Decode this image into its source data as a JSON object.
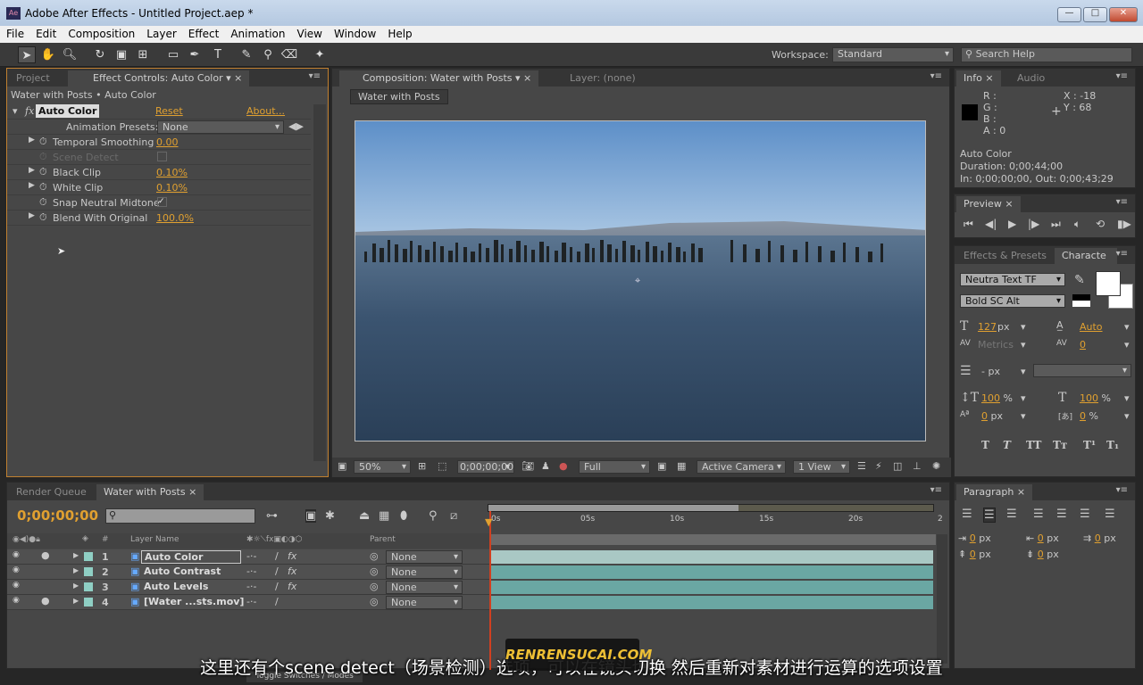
{
  "window": {
    "title": "Adobe After Effects - Untitled Project.aep *",
    "logo": "Ae"
  },
  "menu": [
    "File",
    "Edit",
    "Composition",
    "Layer",
    "Effect",
    "Animation",
    "View",
    "Window",
    "Help"
  ],
  "toolbar": {
    "workspace_label": "Workspace:",
    "workspace_value": "Standard",
    "search_placeholder": "Search Help"
  },
  "left_panel": {
    "tabs": [
      "Project",
      "Effect Controls: Auto Color"
    ],
    "breadcrumb": "Water with Posts • Auto Color",
    "effect": {
      "name": "Auto Color",
      "reset": "Reset",
      "about": "About...",
      "presets_label": "Animation Presets:",
      "presets_value": "None",
      "params": [
        {
          "label": "Temporal Smoothing",
          "value": "0.00",
          "expandable": true
        },
        {
          "label": "Scene Detect",
          "value": "",
          "disabled": true
        },
        {
          "label": "Black Clip",
          "value": "0.10%",
          "expandable": true
        },
        {
          "label": "White Clip",
          "value": "0.10%",
          "expandable": true
        },
        {
          "label": "Snap Neutral Midtone",
          "value": "✓"
        },
        {
          "label": "Blend With Original",
          "value": "100.0%",
          "expandable": true
        }
      ]
    }
  },
  "comp_panel": {
    "tabs": [
      "Composition: Water with Posts",
      "Layer: (none)"
    ],
    "comp_button": "Water with Posts",
    "footer": {
      "zoom": "50%",
      "timecode": "0;00;00;00",
      "resolution": "Full",
      "camera": "Active Camera",
      "view": "1 View"
    }
  },
  "info_panel": {
    "tabs": [
      "Info",
      "Audio"
    ],
    "r": "R :",
    "g": "G :",
    "b": "B :",
    "a": "A : 0",
    "x": "X : -18",
    "y": "Y : 68",
    "layer": "Auto Color",
    "duration": "Duration: 0;00;44;00",
    "inout": "In: 0;00;00;00, Out: 0;00;43;29"
  },
  "preview_panel": {
    "tab": "Preview"
  },
  "character_panel": {
    "tabs": [
      "Effects & Presets",
      "Characte"
    ],
    "font": "Neutra Text TF",
    "style": "Bold SC Alt",
    "size": "127",
    "size_unit": "px",
    "leading": "Auto",
    "kerning": "Metrics",
    "tracking": "0",
    "stroke": "-",
    "stroke_unit": "px",
    "vscale": "100",
    "hscale": "100",
    "baseline": "0",
    "tsume": "0",
    "pct": "%",
    "px": "px",
    "styles": [
      "T",
      "T",
      "TT",
      "Tт",
      "T¹",
      "T₁"
    ]
  },
  "paragraph_panel": {
    "tab": "Paragraph",
    "indents": [
      "0",
      "0",
      "0",
      "0",
      "0"
    ],
    "unit": "px"
  },
  "timeline": {
    "tabs": [
      "Render Queue",
      "Water with Posts"
    ],
    "timecode": "0;00;00;00",
    "ruler": [
      "0s",
      "05s",
      "10s",
      "15s",
      "20s",
      "2"
    ],
    "col_layer_name": "Layer Name",
    "col_parent": "Parent",
    "col_num": "#",
    "layers": [
      {
        "num": "1",
        "name": "Auto Color",
        "fx": "fx",
        "parent": "None"
      },
      {
        "num": "2",
        "name": "Auto Contrast",
        "fx": "fx",
        "parent": "None"
      },
      {
        "num": "3",
        "name": "Auto Levels",
        "fx": "fx",
        "parent": "None"
      },
      {
        "num": "4",
        "name": "[Water ...sts.mov]",
        "fx": "",
        "parent": "None"
      }
    ],
    "toggle": "Toggle Switches / Modes"
  },
  "subtitle": "这里还有个scene detect（场景检测）选项，可以在镜头切换 然后重新对素材进行运算的选项设置",
  "watermark": "RENRENSUCAI.COM",
  "colors": {
    "accent": "#e0a030",
    "layer_bar": "#6aa7a3",
    "label": "#8fcfc4"
  }
}
